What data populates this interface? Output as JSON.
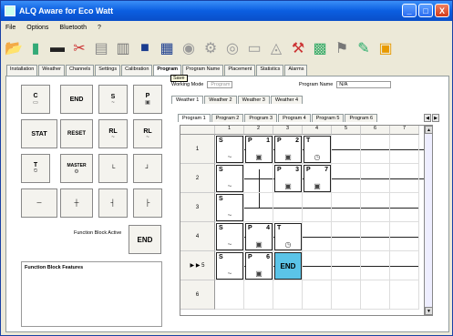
{
  "title": "ALQ Aware for Eco Watt",
  "menu": [
    "File",
    "Options",
    "Bluetooth",
    "?"
  ],
  "window_buttons": [
    "_",
    "□",
    "X"
  ],
  "toolbar_icons": [
    "open-icon",
    "new-icon",
    "delete-icon",
    "cut-icon",
    "copy-icon",
    "paste-icon",
    "save-icon",
    "save-as-icon",
    "monitor-icon",
    "settings-icon",
    "zoom-icon",
    "contact-icon",
    "lock-icon",
    "tools-icon",
    "chart-icon",
    "flag-icon",
    "edit-icon",
    "exit-icon"
  ],
  "main_tabs": [
    "Installation",
    "Weather",
    "Channels",
    "Settings",
    "Calibration",
    "Program",
    "Program Name",
    "Placement",
    "Statistics",
    "Alarms"
  ],
  "active_tab": "Program",
  "tooltip": "Save",
  "palette": {
    "c": {
      "label": "C",
      "sub": ""
    },
    "end": {
      "label": "END"
    },
    "s": {
      "label": "S",
      "sub": "~"
    },
    "p": {
      "label": "P",
      "sub": ""
    },
    "stat": {
      "label": "STAT"
    },
    "reset": {
      "label": "RESET"
    },
    "rl1": {
      "label": "RL",
      "sub": "~"
    },
    "rl2": {
      "label": "RL",
      "sub": "~"
    },
    "t": {
      "label": "T",
      "sub": "⏲"
    },
    "master": {
      "label": "MASTER",
      "sub": "⚙"
    }
  },
  "function_block_label": "Function Block Active",
  "function_block_value": "END",
  "features_label": "Function Block Features",
  "working_mode_label": "Working Mode",
  "working_mode_value": "Program",
  "program_name_label": "Program Name",
  "program_name_value": "N/A",
  "weather_tabs": [
    "Weather 1",
    "Weather 2",
    "Weather 3",
    "Weather 4"
  ],
  "program_tabs": [
    "Program 1",
    "Program 2",
    "Program 3",
    "Program 4",
    "Program 5",
    "Program 6"
  ],
  "columns": [
    "",
    "1",
    "2",
    "3",
    "4",
    "5",
    "6",
    "7"
  ],
  "rows": [
    {
      "label": "1",
      "marker": ""
    },
    {
      "label": "2",
      "marker": ""
    },
    {
      "label": "3",
      "marker": ""
    },
    {
      "label": "4",
      "marker": ""
    },
    {
      "label": "5",
      "marker": "▶ ▶"
    },
    {
      "label": "6",
      "marker": ""
    }
  ],
  "blocks": [
    {
      "id": "r1c1",
      "type": "S",
      "num": "",
      "glyph": "~"
    },
    {
      "id": "r1c2",
      "type": "P",
      "num": "1",
      "glyph": "▣"
    },
    {
      "id": "r1c3",
      "type": "P",
      "num": "2",
      "glyph": "▣"
    },
    {
      "id": "r1c4",
      "type": "T",
      "num": "",
      "glyph": "◷"
    },
    {
      "id": "r2c1",
      "type": "S",
      "num": "",
      "glyph": "~"
    },
    {
      "id": "r2c3",
      "type": "P",
      "num": "3",
      "glyph": "▣"
    },
    {
      "id": "r2c4",
      "type": "P",
      "num": "7",
      "glyph": "▣"
    },
    {
      "id": "r3c1",
      "type": "S",
      "num": "",
      "glyph": "~"
    },
    {
      "id": "r4c1",
      "type": "S",
      "num": "",
      "glyph": "~"
    },
    {
      "id": "r4c2",
      "type": "P",
      "num": "4",
      "glyph": "▣"
    },
    {
      "id": "r4c3",
      "type": "T",
      "num": "",
      "glyph": "◷"
    },
    {
      "id": "r5c1",
      "type": "S",
      "num": "",
      "glyph": "~"
    },
    {
      "id": "r5c2",
      "type": "P",
      "num": "6",
      "glyph": "▣"
    },
    {
      "id": "r5c3",
      "type": "END",
      "num": "",
      "glyph": ""
    }
  ]
}
